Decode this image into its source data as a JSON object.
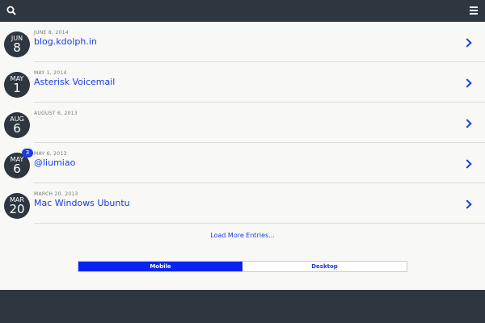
{
  "header": {
    "title": "",
    "search_icon": "search-icon",
    "menu_icon": "hamburger-menu-icon"
  },
  "entries": [
    {
      "month": "JUN",
      "day": "8",
      "date": "JUNE 8, 2014",
      "title": "blog.kdolph.in",
      "badge": ""
    },
    {
      "month": "MAY",
      "day": "1",
      "date": "MAY 1, 2014",
      "title": "Asterisk  Voicemail ",
      "badge": ""
    },
    {
      "month": "AUG",
      "day": "6",
      "date": "AUGUST 6, 2013",
      "title": "",
      "badge": ""
    },
    {
      "month": "MAY",
      "day": "6",
      "date": "MAY 6, 2013",
      "title": " @liumiao ",
      "badge": "3"
    },
    {
      "month": "MAR",
      "day": "20",
      "date": "MARCH 20, 2013",
      "title": "Mac Windows Ubuntu ",
      "badge": ""
    }
  ],
  "load_more": "Load More Entries...",
  "switcher": {
    "mobile": "Mobile",
    "desktop": "Desktop"
  },
  "colors": {
    "dark": "#2e3640",
    "accent": "#1a3ce0",
    "active": "#0a24f0"
  }
}
